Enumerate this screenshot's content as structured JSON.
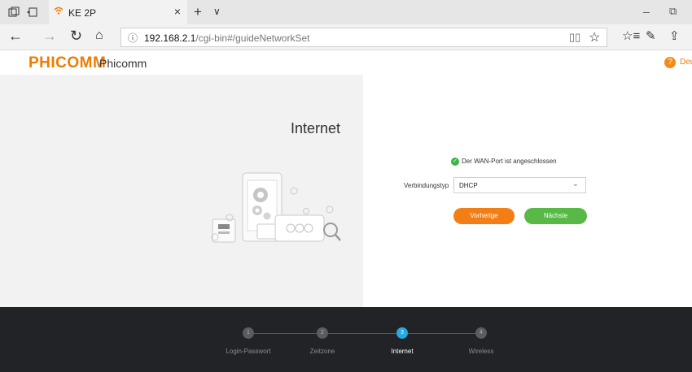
{
  "browser": {
    "tab_title": "KE 2P",
    "tab_close": "×",
    "new_tab": "+",
    "tab_list": "∨",
    "url_host": "192.168.2.1",
    "url_path": "/cgi-bin#/guideNetworkSet",
    "window_minimize": "–",
    "window_maximize": "⧉"
  },
  "header": {
    "logo": "PHICOMM",
    "brand": "Phicomm",
    "language": "Deu",
    "help_glyph": "?"
  },
  "left": {
    "title": "Internet"
  },
  "form": {
    "wan_status": "Der WAN-Port ist angeschlossen",
    "connection_type_label": "Verbindungstyp",
    "connection_type_value": "DHCP",
    "prev_button": "Vorherige",
    "next_button": "Nächste"
  },
  "steps": [
    {
      "num": "1",
      "label": "Login-Passwort",
      "active": false
    },
    {
      "num": "2",
      "label": "Zeitzone",
      "active": false
    },
    {
      "num": "3",
      "label": "Internet",
      "active": true
    },
    {
      "num": "4",
      "label": "Wireless",
      "active": false
    }
  ],
  "colors": {
    "accent_orange": "#f07c00",
    "next_green": "#58b947",
    "step_active_blue": "#26a8e0",
    "footer_bg": "#222326"
  }
}
